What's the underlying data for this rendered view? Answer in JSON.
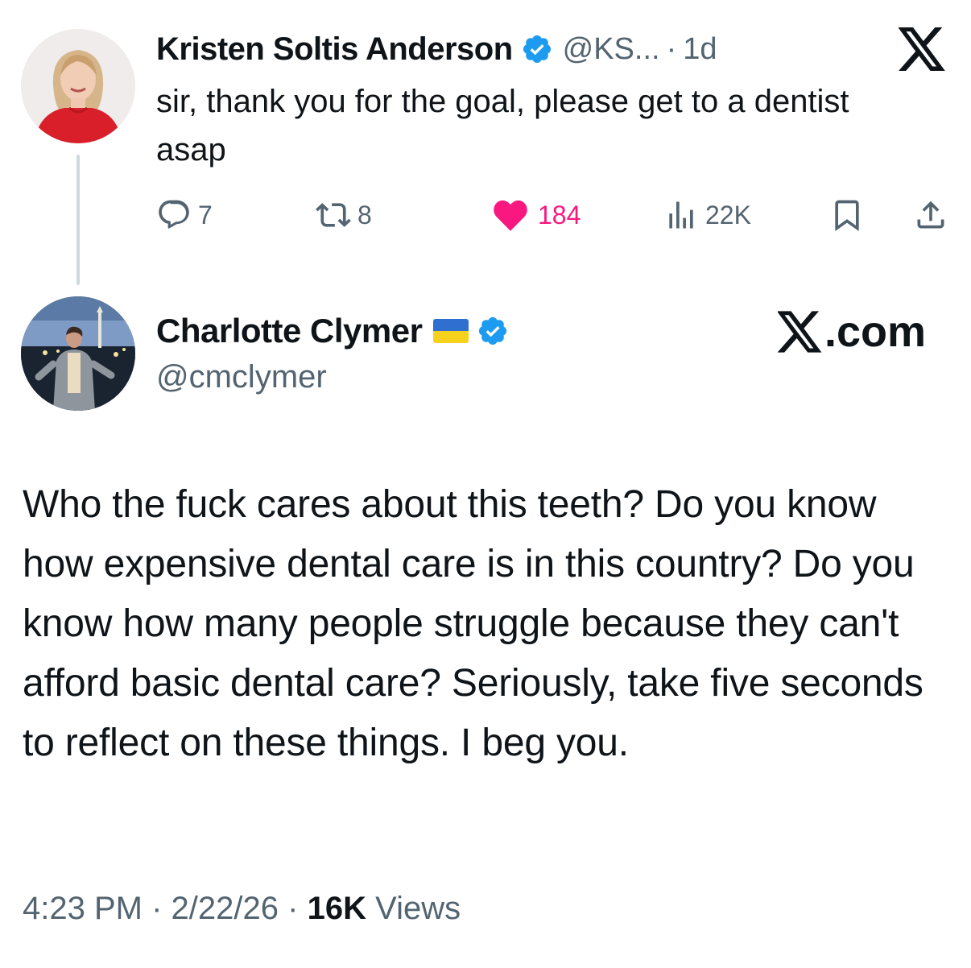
{
  "parent_tweet": {
    "author_name": "Kristen Soltis Anderson",
    "handle": "@KS...",
    "separator": "·",
    "time_ago": "1d",
    "text": "sir, thank you for the goal, please get to a dentist asap",
    "actions": {
      "replies": "7",
      "retweets": "8",
      "likes": "184",
      "views": "22K"
    },
    "like_color": "#f91880",
    "verified_color": "#1d9bf0"
  },
  "main_tweet": {
    "author_name": "Charlotte Clymer",
    "handle": "@cmclymer",
    "flag_icon": "ukraine-flag",
    "brand": "X.com",
    "brand_suffix": ".com",
    "text": "Who the fuck cares about this teeth? Do you know how expensive dental care is in this country? Do you know how many people struggle because they can't afford basic dental care? Seriously, take five seconds to reflect on these things. I beg you.",
    "timestamp": "4:23 PM",
    "separator": "·",
    "date": "2/22/26",
    "views_count": "16K",
    "views_label": "Views"
  }
}
